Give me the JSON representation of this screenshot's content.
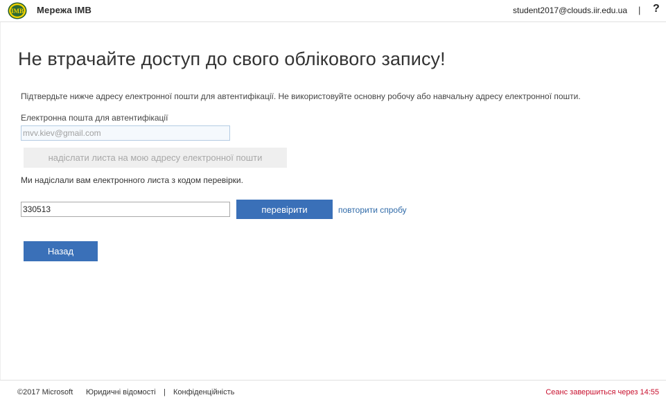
{
  "header": {
    "logo_text": "IMB",
    "brand": "Мережа ІМВ",
    "user_email": "student2017@clouds.iir.edu.ua",
    "separator": "|",
    "help": "?"
  },
  "main": {
    "title": "Не втрачайте доступ до свого облікового запису!",
    "description": "Підтвердьте нижче адресу електронної пошти для автентифікації. Не використовуйте основну робочу або навчальну адресу електронної пошти.",
    "email_label": "Електронна пошта для автентифікації",
    "email_placeholder": "mvv.kiev@gmail.com",
    "email_value": "",
    "send_button": "надіслати листа на мою адресу електронної пошти",
    "sent_message": "Ми надіслали вам електронного листа з кодом перевірки.",
    "code_value": "330513",
    "verify_button": "перевірити",
    "retry_link": "повторити спробу",
    "back_button": "Назад"
  },
  "footer": {
    "copyright": "©2017 Microsoft",
    "legal": "Юридичні відомості",
    "separator": "|",
    "privacy": "Конфіденційність",
    "session": "Сеанс завершиться через 14:55"
  },
  "colors": {
    "accent": "#3a70b8",
    "link": "#2f6aa8",
    "session_warning": "#c8102e",
    "disabled_button": "#efefef",
    "logo_yellow": "#f4d400",
    "logo_green": "#1f5a2a"
  }
}
